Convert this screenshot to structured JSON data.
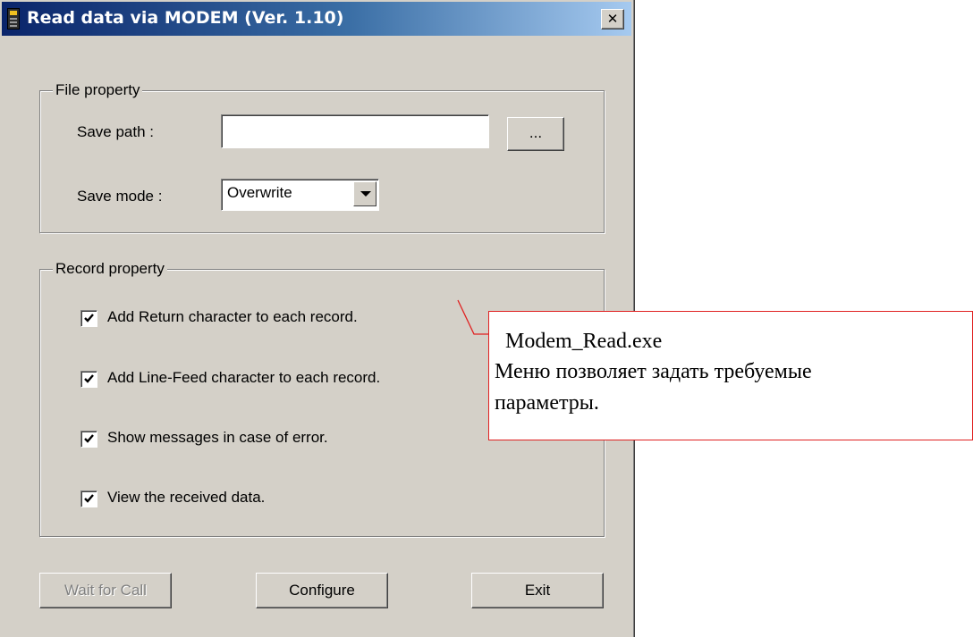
{
  "window": {
    "title": "Read data via MODEM (Ver. 1.10)",
    "close_glyph": "✕"
  },
  "file_property": {
    "legend": "File property",
    "save_path_label": "Save path :",
    "save_path_value": "",
    "browse_label": "...",
    "save_mode_label": "Save mode :",
    "save_mode_value": "Overwrite"
  },
  "record_property": {
    "legend": "Record property",
    "options": [
      {
        "label": "Add Return character to each record.",
        "checked": true
      },
      {
        "label": "Add Line-Feed character to each record.",
        "checked": true
      },
      {
        "label": "Show messages in case of error.",
        "checked": true
      },
      {
        "label": "View the received data.",
        "checked": true
      }
    ]
  },
  "buttons": {
    "wait_label": "Wait for Call",
    "configure_label": "Configure",
    "exit_label": "Exit"
  },
  "callout": {
    "line1": "Modem_Read.exe",
    "line2": "Меню позволяет задать требуемые",
    "line3": "параметры."
  },
  "colors": {
    "title_start": "#0a246a",
    "title_end": "#a6caf0",
    "window_bg": "#d4d0c8",
    "callout_border": "#e02020"
  },
  "icons": {
    "app": "handheld-terminal-icon",
    "close": "close-icon",
    "dropdown": "chevron-down-icon",
    "check": "checkmark-icon"
  }
}
